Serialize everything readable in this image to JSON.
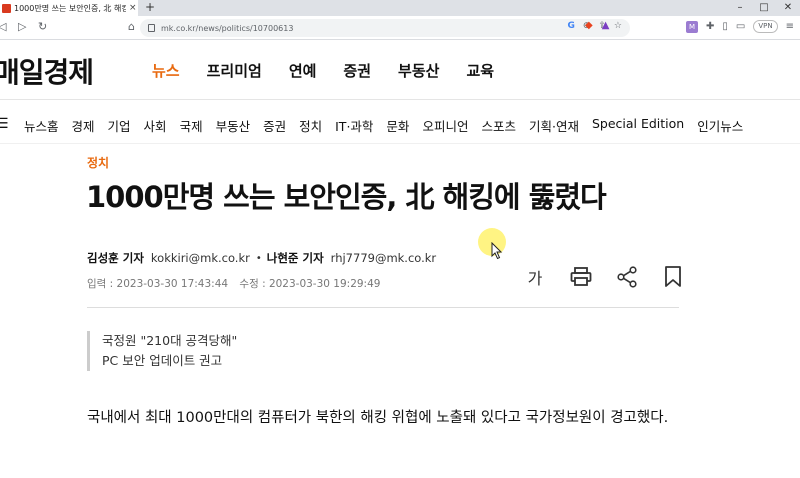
{
  "browser": {
    "tab_title": "1000만명 쓰는 보안인증, 北 해킹",
    "tab_close": "×",
    "new_tab": "+",
    "url": "mk.co.kr/news/politics/10700613",
    "vpn_label": "VPN",
    "ext_badge": "M"
  },
  "site": {
    "logo": "매일경제",
    "main_nav": [
      "뉴스",
      "프리미엄",
      "연예",
      "증권",
      "부동산",
      "교육"
    ],
    "active_nav": "뉴스",
    "sub_nav": [
      "뉴스홈",
      "경제",
      "기업",
      "사회",
      "국제",
      "부동산",
      "증권",
      "정치",
      "IT·과학",
      "문화",
      "오피니언",
      "스포츠",
      "기획·연재",
      "Special Edition",
      "인기뉴스"
    ]
  },
  "article": {
    "category": "정치",
    "headline": "1000만명 쓰는 보안인증, 北 해킹에 뚫렸다",
    "reporters": [
      {
        "name": "김성훈 기자",
        "email": "kokkiri@mk.co.kr"
      },
      {
        "name": "나현준 기자",
        "email": "rhj7779@mk.co.kr"
      }
    ],
    "published": "입력 : 2023-03-30 17:43:44",
    "modified": "수정 : 2023-03-30 19:29:49",
    "font_tool": "가",
    "summary": [
      "국정원 \"210대 공격당해\"",
      "PC 보안 업데이트 권고"
    ],
    "body": "국내에서 최대 1000만대의 컴퓨터가 북한의 해킹 위협에 노출돼 있다고 국가정보원이 경고했다."
  },
  "colors": {
    "accent": "#e86a10",
    "favicon": "#d93a1f"
  }
}
